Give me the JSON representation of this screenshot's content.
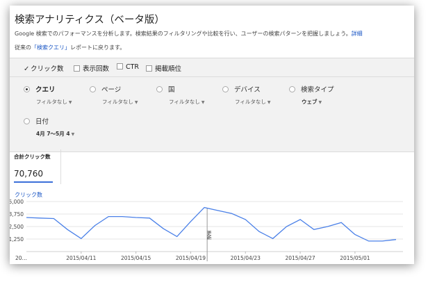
{
  "page": {
    "title": "検索アナリティクス（ベータ版）",
    "description": "Google 検索でのパフォーマンスを分析します。検索結果のフィルタリングや比較を行い、ユーザーの検索パターンを把握しましょう。",
    "details_link": "詳細",
    "back_prefix": "従来の",
    "back_link": "「検索クエリ」",
    "back_suffix": "レポートに戻ります。"
  },
  "metrics": [
    {
      "label": "クリック数",
      "checked": true
    },
    {
      "label": "表示回数",
      "checked": false
    },
    {
      "label": "CTR",
      "checked": false
    },
    {
      "label": "掲載順位",
      "checked": false
    }
  ],
  "dimensions": [
    {
      "label": "クエリ",
      "selected": true,
      "sub": "フィルタなし"
    },
    {
      "label": "ページ",
      "selected": false,
      "sub": "フィルタなし"
    },
    {
      "label": "国",
      "selected": false,
      "sub": "フィルタなし"
    },
    {
      "label": "デバイス",
      "selected": false,
      "sub": "フィルタなし"
    },
    {
      "label": "検索タイプ",
      "selected": false,
      "sub": "ウェブ"
    },
    {
      "label": "日付",
      "selected": false,
      "sub": "4月 7～5月 4"
    }
  ],
  "summary": {
    "label": "合計クリック数",
    "value": "70,760"
  },
  "chart_data": {
    "type": "line",
    "legend": "クリック数",
    "y_tick_labels": [
      "5,000",
      "3,750",
      "2,500",
      "1,250"
    ],
    "x_tick_labels": [
      "20…",
      "2015/04/11",
      "2015/04/15",
      "2015/04/19",
      "2015/04/23",
      "2015/04/27",
      "2015/05/01"
    ],
    "x": [
      "2015/04/07",
      "2015/04/08",
      "2015/04/09",
      "2015/04/10",
      "2015/04/11",
      "2015/04/12",
      "2015/04/13",
      "2015/04/14",
      "2015/04/15",
      "2015/04/16",
      "2015/04/17",
      "2015/04/18",
      "2015/04/19",
      "2015/04/20",
      "2015/04/21",
      "2015/04/22",
      "2015/04/23",
      "2015/04/24",
      "2015/04/25",
      "2015/04/26",
      "2015/04/27",
      "2015/04/28",
      "2015/04/29",
      "2015/04/30",
      "2015/05/01",
      "2015/05/02",
      "2015/05/03",
      "2015/05/04"
    ],
    "values": [
      3400,
      3350,
      3300,
      2200,
      1300,
      2600,
      3500,
      3500,
      3400,
      3350,
      2300,
      1500,
      3000,
      4400,
      4100,
      3800,
      3200,
      2000,
      1300,
      2500,
      3200,
      2200,
      2500,
      2900,
      1700,
      1050,
      1050,
      1200
    ],
    "ylim": [
      0,
      5000
    ],
    "y_ticks": [
      1250,
      2500,
      3750,
      5000
    ],
    "grid": true,
    "annotation": {
      "x": "2015/04/20",
      "label": "更新"
    },
    "colors": {
      "line": "#4a80e8",
      "grid": "#e5e5e5",
      "marker": "#999999"
    }
  }
}
